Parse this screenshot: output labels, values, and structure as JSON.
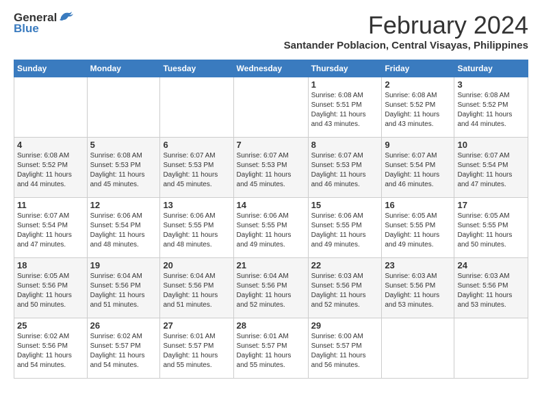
{
  "logo": {
    "general": "General",
    "blue": "Blue"
  },
  "title": "February 2024",
  "subtitle": "Santander Poblacion, Central Visayas, Philippines",
  "days_of_week": [
    "Sunday",
    "Monday",
    "Tuesday",
    "Wednesday",
    "Thursday",
    "Friday",
    "Saturday"
  ],
  "weeks": [
    [
      {
        "day": "",
        "info": ""
      },
      {
        "day": "",
        "info": ""
      },
      {
        "day": "",
        "info": ""
      },
      {
        "day": "",
        "info": ""
      },
      {
        "day": "1",
        "info": "Sunrise: 6:08 AM\nSunset: 5:51 PM\nDaylight: 11 hours\nand 43 minutes."
      },
      {
        "day": "2",
        "info": "Sunrise: 6:08 AM\nSunset: 5:52 PM\nDaylight: 11 hours\nand 43 minutes."
      },
      {
        "day": "3",
        "info": "Sunrise: 6:08 AM\nSunset: 5:52 PM\nDaylight: 11 hours\nand 44 minutes."
      }
    ],
    [
      {
        "day": "4",
        "info": "Sunrise: 6:08 AM\nSunset: 5:52 PM\nDaylight: 11 hours\nand 44 minutes."
      },
      {
        "day": "5",
        "info": "Sunrise: 6:08 AM\nSunset: 5:53 PM\nDaylight: 11 hours\nand 45 minutes."
      },
      {
        "day": "6",
        "info": "Sunrise: 6:07 AM\nSunset: 5:53 PM\nDaylight: 11 hours\nand 45 minutes."
      },
      {
        "day": "7",
        "info": "Sunrise: 6:07 AM\nSunset: 5:53 PM\nDaylight: 11 hours\nand 45 minutes."
      },
      {
        "day": "8",
        "info": "Sunrise: 6:07 AM\nSunset: 5:53 PM\nDaylight: 11 hours\nand 46 minutes."
      },
      {
        "day": "9",
        "info": "Sunrise: 6:07 AM\nSunset: 5:54 PM\nDaylight: 11 hours\nand 46 minutes."
      },
      {
        "day": "10",
        "info": "Sunrise: 6:07 AM\nSunset: 5:54 PM\nDaylight: 11 hours\nand 47 minutes."
      }
    ],
    [
      {
        "day": "11",
        "info": "Sunrise: 6:07 AM\nSunset: 5:54 PM\nDaylight: 11 hours\nand 47 minutes."
      },
      {
        "day": "12",
        "info": "Sunrise: 6:06 AM\nSunset: 5:54 PM\nDaylight: 11 hours\nand 48 minutes."
      },
      {
        "day": "13",
        "info": "Sunrise: 6:06 AM\nSunset: 5:55 PM\nDaylight: 11 hours\nand 48 minutes."
      },
      {
        "day": "14",
        "info": "Sunrise: 6:06 AM\nSunset: 5:55 PM\nDaylight: 11 hours\nand 49 minutes."
      },
      {
        "day": "15",
        "info": "Sunrise: 6:06 AM\nSunset: 5:55 PM\nDaylight: 11 hours\nand 49 minutes."
      },
      {
        "day": "16",
        "info": "Sunrise: 6:05 AM\nSunset: 5:55 PM\nDaylight: 11 hours\nand 49 minutes."
      },
      {
        "day": "17",
        "info": "Sunrise: 6:05 AM\nSunset: 5:55 PM\nDaylight: 11 hours\nand 50 minutes."
      }
    ],
    [
      {
        "day": "18",
        "info": "Sunrise: 6:05 AM\nSunset: 5:56 PM\nDaylight: 11 hours\nand 50 minutes."
      },
      {
        "day": "19",
        "info": "Sunrise: 6:04 AM\nSunset: 5:56 PM\nDaylight: 11 hours\nand 51 minutes."
      },
      {
        "day": "20",
        "info": "Sunrise: 6:04 AM\nSunset: 5:56 PM\nDaylight: 11 hours\nand 51 minutes."
      },
      {
        "day": "21",
        "info": "Sunrise: 6:04 AM\nSunset: 5:56 PM\nDaylight: 11 hours\nand 52 minutes."
      },
      {
        "day": "22",
        "info": "Sunrise: 6:03 AM\nSunset: 5:56 PM\nDaylight: 11 hours\nand 52 minutes."
      },
      {
        "day": "23",
        "info": "Sunrise: 6:03 AM\nSunset: 5:56 PM\nDaylight: 11 hours\nand 53 minutes."
      },
      {
        "day": "24",
        "info": "Sunrise: 6:03 AM\nSunset: 5:56 PM\nDaylight: 11 hours\nand 53 minutes."
      }
    ],
    [
      {
        "day": "25",
        "info": "Sunrise: 6:02 AM\nSunset: 5:56 PM\nDaylight: 11 hours\nand 54 minutes."
      },
      {
        "day": "26",
        "info": "Sunrise: 6:02 AM\nSunset: 5:57 PM\nDaylight: 11 hours\nand 54 minutes."
      },
      {
        "day": "27",
        "info": "Sunrise: 6:01 AM\nSunset: 5:57 PM\nDaylight: 11 hours\nand 55 minutes."
      },
      {
        "day": "28",
        "info": "Sunrise: 6:01 AM\nSunset: 5:57 PM\nDaylight: 11 hours\nand 55 minutes."
      },
      {
        "day": "29",
        "info": "Sunrise: 6:00 AM\nSunset: 5:57 PM\nDaylight: 11 hours\nand 56 minutes."
      },
      {
        "day": "",
        "info": ""
      },
      {
        "day": "",
        "info": ""
      }
    ]
  ]
}
